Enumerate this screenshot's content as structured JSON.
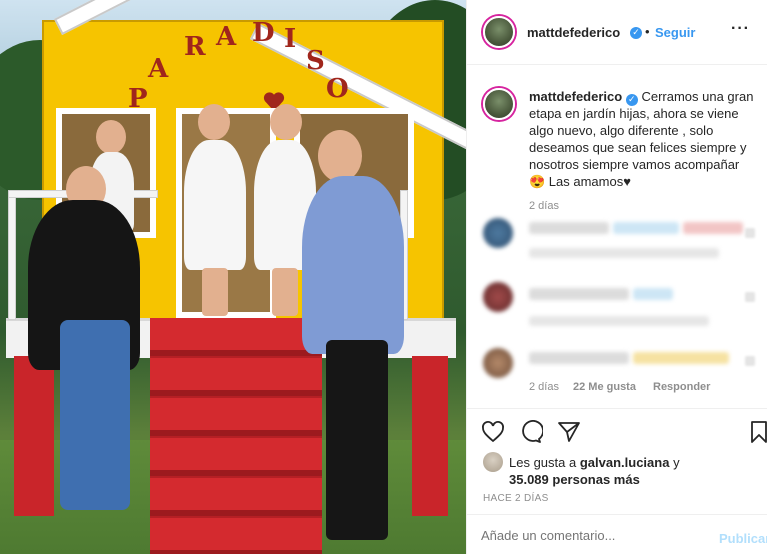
{
  "post": {
    "author": "mattdefederico",
    "follow_label": "Seguir",
    "separator": "•",
    "more_label": "···",
    "caption_user": "mattdefederico",
    "caption_text": "Cerramos una gran etapa en jardín hijas, ahora se viene algo nuevo, algo diferente , solo deseamos que sean felices siempre y nosotros siempre vamos acompañar😍 Las amamos♥",
    "caption_time": "2 días",
    "verified_mark": "✓"
  },
  "photo": {
    "sign_letters": [
      "P",
      "A",
      "R",
      "A",
      "D",
      "I",
      "S",
      "O"
    ]
  },
  "comments": [
    {
      "time": "",
      "likes": "",
      "reply": ""
    },
    {
      "time": "",
      "likes": "",
      "reply": ""
    },
    {
      "time": "2 días",
      "likes": "22 Me gusta",
      "reply": "Responder"
    }
  ],
  "actions": {
    "like_icon": "heart-icon",
    "comment_icon": "comment-icon",
    "share_icon": "share-icon",
    "save_icon": "bookmark-icon"
  },
  "likes": {
    "prefix": "Les gusta a",
    "user": "galvan.luciana",
    "connector": "y",
    "count": "35.089 personas más"
  },
  "timestamp": "HACE 2 DÍAS",
  "comment_box": {
    "placeholder": "Añade un comentario...",
    "publish_label": "Publicar"
  },
  "colors": {
    "link": "#3897f0",
    "publish_disabled": "#b2dffc",
    "house": "#f6c400",
    "stairs": "#d42a2f"
  }
}
